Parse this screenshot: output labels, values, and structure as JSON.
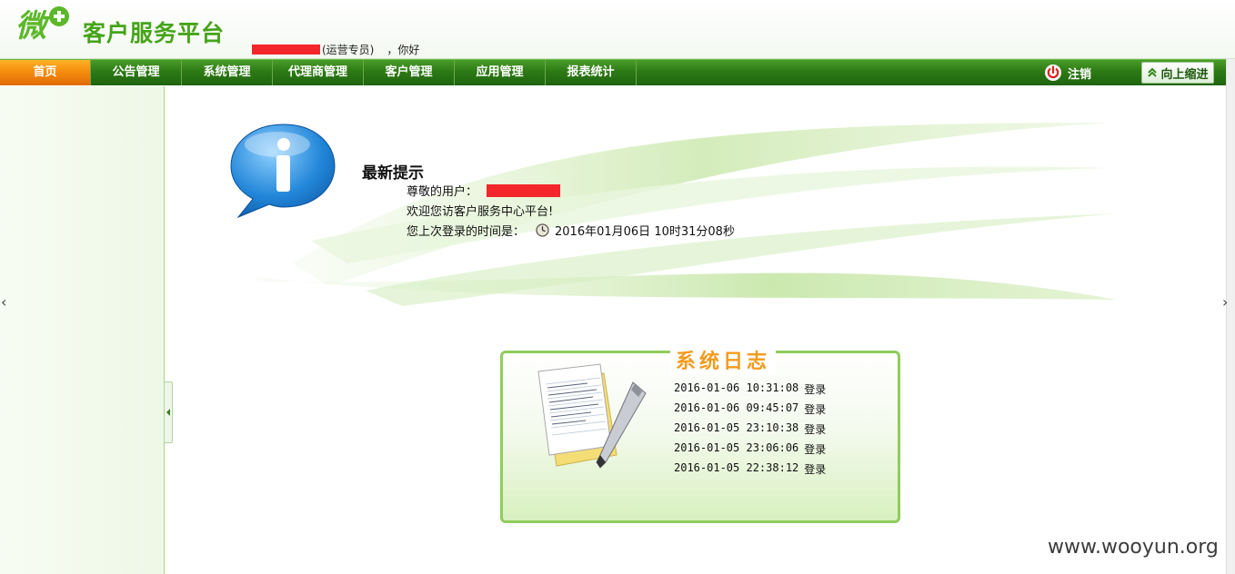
{
  "header": {
    "logo_glyph": "微",
    "logo_text": "客户服务平台",
    "greeting_role": "(运营专员)",
    "greeting_suffix": "，你好"
  },
  "nav": {
    "items": [
      {
        "label": "首页",
        "active": true
      },
      {
        "label": "公告管理"
      },
      {
        "label": "系统管理"
      },
      {
        "label": "代理商管理"
      },
      {
        "label": "客户管理"
      },
      {
        "label": "应用管理"
      },
      {
        "label": "报表统计"
      }
    ],
    "logout_label": "注销",
    "collapse_label": "向上缩进"
  },
  "notice": {
    "title": "最新提示",
    "user_label": "尊敬的用户：",
    "welcome": "欢迎您访客户服务中心平台!",
    "last_login_label": "您上次登录的时间是：",
    "last_login_time": "2016年01月06日 10时31分08秒"
  },
  "system_log": {
    "title": "系统日志",
    "entries": [
      {
        "time": "2016-01-06 10:31:08",
        "action": "登录"
      },
      {
        "time": "2016-01-06 09:45:07",
        "action": "登录"
      },
      {
        "time": "2016-01-05 23:10:38",
        "action": "登录"
      },
      {
        "time": "2016-01-05 23:06:06",
        "action": "登录"
      },
      {
        "time": "2016-01-05 22:38:12",
        "action": "登录"
      }
    ]
  },
  "watermark": "www.wooyun.org",
  "colors": {
    "brand_green": "#46a419",
    "nav_green": "#2d7a14",
    "nav_active_orange": "#f48a0c",
    "log_title_orange": "#f29b1d",
    "redaction_red": "#f2262b"
  }
}
